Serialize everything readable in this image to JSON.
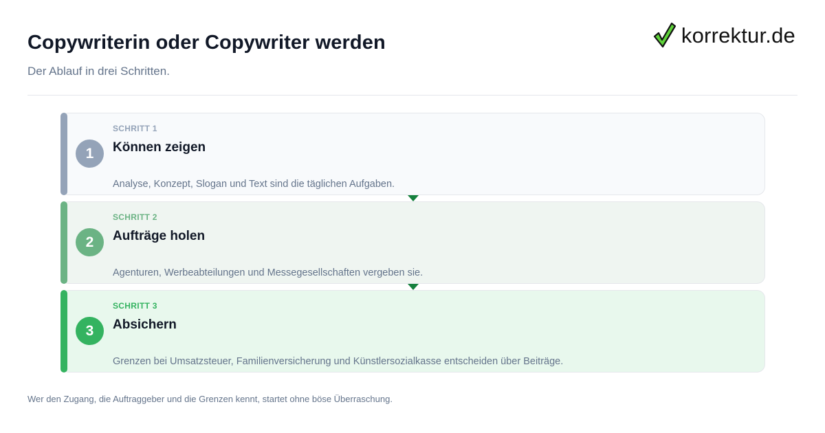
{
  "header": {
    "title": "Copywriterin oder Copywriter werden",
    "subtitle": "Der Ablauf in drei Schritten."
  },
  "logo": {
    "text": "korrektur.de",
    "icon": "checkmark-icon"
  },
  "steps": [
    {
      "number": "1",
      "eyebrow": "SCHRITT 1",
      "title": "Können zeigen",
      "description": "Analyse, Konzept, Slogan und Text sind die täglichen Aufgaben.",
      "color": "#94a3b8"
    },
    {
      "number": "2",
      "eyebrow": "SCHRITT 2",
      "title": "Aufträge holen",
      "description": "Agenturen, Werbeabteilungen und Messegesellschaften vergeben sie.",
      "color": "#6bb384"
    },
    {
      "number": "3",
      "eyebrow": "SCHRITT 3",
      "title": "Absichern",
      "description": "Grenzen bei Umsatzsteuer, Familienversicherung und Künstlersozialkasse entscheiden über Beiträge.",
      "color": "#34b360"
    }
  ],
  "connector_color": "#15803d",
  "footer": {
    "text": "Wer den Zugang, die Auftraggeber und die Grenzen kennt, startet ohne böse Überraschung."
  }
}
